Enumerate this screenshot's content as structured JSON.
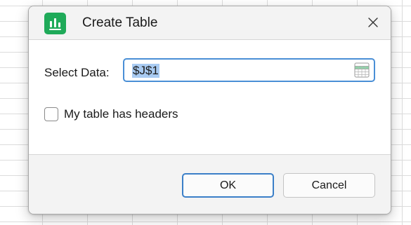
{
  "dialog": {
    "title": "Create Table",
    "app_icon": "spreadsheet-chart-icon",
    "close_icon": "close-icon",
    "accent_color": "#1faa59",
    "focus_color": "#4a8fd6"
  },
  "form": {
    "select_data_label": "Select Data:",
    "range_value": "$J$1",
    "range_picker_icon": "range-selector-icon",
    "headers_checkbox_label": "My table has headers",
    "headers_checked": false
  },
  "buttons": {
    "ok_label": "OK",
    "cancel_label": "Cancel"
  }
}
